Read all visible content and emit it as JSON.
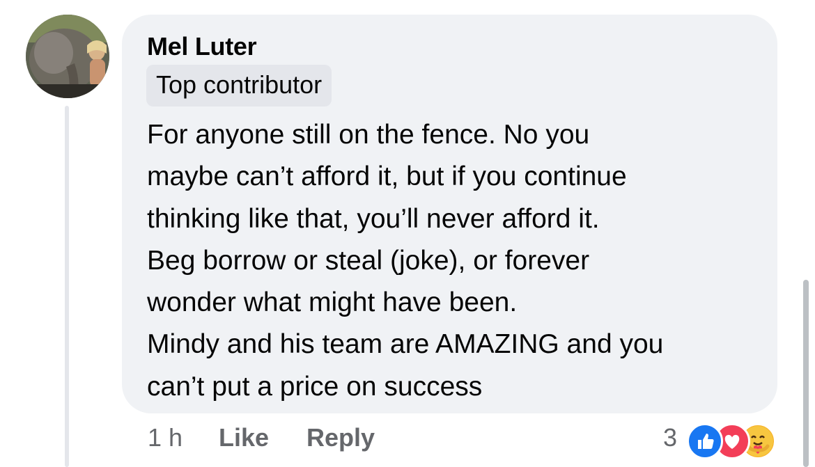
{
  "comment": {
    "author": "Mel Luter",
    "badge": "Top contributor",
    "lines": [
      "For anyone still on the fence. No you",
      "maybe can’t afford it, but if you continue",
      "thinking like that, you’ll never afford it.",
      "Beg borrow or steal (joke), or forever",
      "wonder what might have been.",
      "Mindy and his team are AMAZING and you",
      "can’t put a price on success"
    ]
  },
  "actions": {
    "time": "1 h",
    "like_label": "Like",
    "reply_label": "Reply"
  },
  "reactions": {
    "count": "3",
    "icons": [
      "like-reaction-icon",
      "love-reaction-icon",
      "care-reaction-icon"
    ]
  },
  "colors": {
    "bubble": "#f0f2f5",
    "badge": "#e4e6eb",
    "text": "#050505",
    "muted": "#65676b",
    "like_blue": "#1877f2",
    "love_red": "#f33e58",
    "care_yellow": "#f7b125"
  }
}
